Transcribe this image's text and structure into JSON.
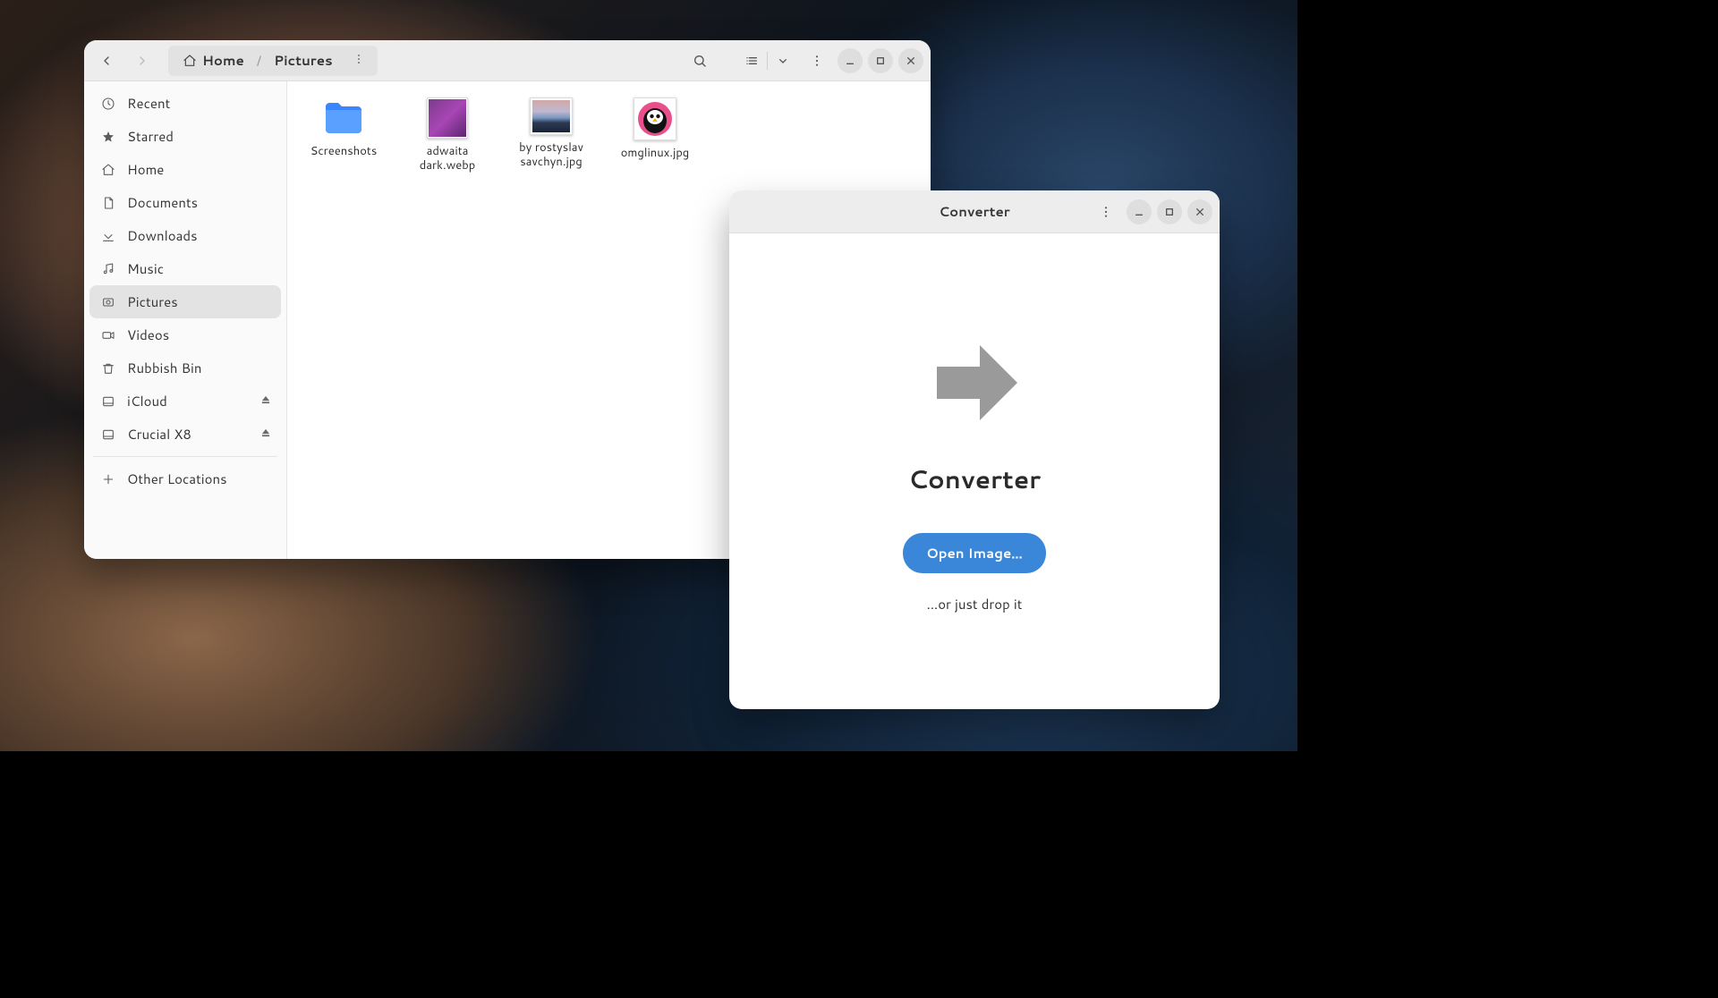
{
  "file_manager": {
    "path": {
      "home_label": "Home",
      "current_label": "Pictures"
    },
    "sidebar": {
      "items": [
        {
          "label": "Recent"
        },
        {
          "label": "Starred"
        },
        {
          "label": "Home"
        },
        {
          "label": "Documents"
        },
        {
          "label": "Downloads"
        },
        {
          "label": "Music"
        },
        {
          "label": "Pictures"
        },
        {
          "label": "Videos"
        },
        {
          "label": "Rubbish Bin"
        },
        {
          "label": "iCloud"
        },
        {
          "label": "Crucial X8"
        }
      ],
      "other_locations": "Other Locations"
    },
    "files": [
      {
        "name": "Screenshots"
      },
      {
        "name": "adwaita dark.webp"
      },
      {
        "name": "by rostyslav savchyn.jpg"
      },
      {
        "name": "omglinux.jpg"
      }
    ]
  },
  "converter": {
    "title": "Converter",
    "heading": "Converter",
    "open_button": "Open Image…",
    "hint": "…or just drop it"
  }
}
